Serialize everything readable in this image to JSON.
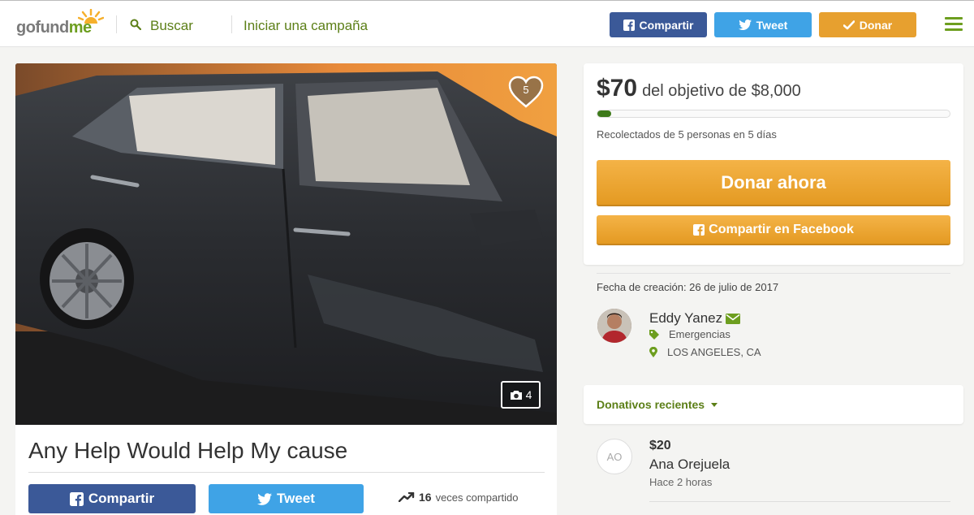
{
  "header": {
    "logo_prefix": "gofund",
    "logo_suffix": "me",
    "search_label": "Buscar",
    "start_campaign": "Iniciar una campaña",
    "share_label": "Compartir",
    "tweet_label": "Tweet",
    "donate_label": "Donar"
  },
  "campaign": {
    "title": "Any Help Would Help My cause",
    "hearts": "5",
    "photo_count": "4",
    "share_label": "Compartir",
    "tweet_label": "Tweet",
    "share_count": "16",
    "share_suffix": "veces compartido"
  },
  "donation": {
    "raised": "$70",
    "goal_text": "del objetivo de $8,000",
    "progress_fraction": 0.009,
    "collected_text": "Recolectados de 5 personas en 5 días",
    "donate_now": "Donar ahora",
    "share_facebook": "Compartir en Facebook"
  },
  "organizer": {
    "created": "Fecha de creación: 26 de julio de 2017",
    "name": "Eddy Yanez",
    "category": "Emergencias",
    "location": "LOS ANGELES, CA"
  },
  "recent": {
    "title": "Donativos recientes",
    "donations": [
      {
        "initials": "AO",
        "amount": "$20",
        "name": "Ana Orejuela",
        "time": "Hace 2 horas"
      }
    ]
  },
  "colors": {
    "brand_green": "#6d9e1f",
    "facebook": "#3b5998",
    "twitter": "#3fa3e6",
    "donate_orange": "#e7a02f"
  },
  "icons": [
    "sun-logo-icon",
    "search-icon",
    "facebook-icon",
    "twitter-icon",
    "check-icon",
    "menu-icon",
    "heart-icon",
    "camera-icon",
    "trending-icon",
    "envelope-icon",
    "tag-icon",
    "location-pin-icon",
    "chevron-down-icon"
  ]
}
